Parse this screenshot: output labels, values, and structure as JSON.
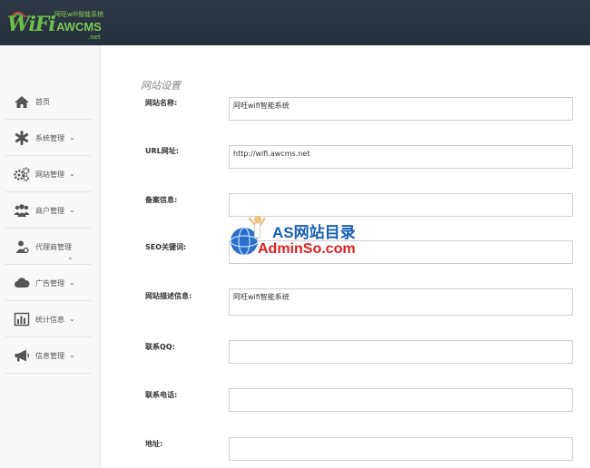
{
  "header": {
    "logo_small_text": "阿旺wifi智能系统",
    "logo_wifi": "WiFi",
    "logo_brand": "AWCMS",
    "logo_net": ".net"
  },
  "sidebar": {
    "items": [
      {
        "label": "首页",
        "icon": "home-icon",
        "has_chevron": false
      },
      {
        "label": "系统管理",
        "icon": "asterisk-icon",
        "has_chevron": true
      },
      {
        "label": "网站管理",
        "icon": "gears-icon",
        "has_chevron": true
      },
      {
        "label": "商户管理",
        "icon": "users-icon",
        "has_chevron": true
      },
      {
        "label": "代理商管理",
        "icon": "agent-icon",
        "has_chevron": true
      },
      {
        "label": "广告管理",
        "icon": "cloud-icon",
        "has_chevron": true
      },
      {
        "label": "统计信息",
        "icon": "bar-chart-icon",
        "has_chevron": true
      },
      {
        "label": "信息管理",
        "icon": "megaphone-icon",
        "has_chevron": true
      }
    ],
    "chevron": "⌄"
  },
  "main": {
    "section_title": "网站设置",
    "fields": [
      {
        "label": "网站名称:",
        "value": "阿旺wifi智能系统"
      },
      {
        "label": "URL网址:",
        "value": "http://wifi.awcms.net"
      },
      {
        "label": "备案信息:",
        "value": ""
      },
      {
        "label": "SEO关键词:",
        "value": ""
      },
      {
        "label": "网站描述信息:",
        "value": "阿旺wifi智能系统"
      },
      {
        "label": "联系QQ:",
        "value": ""
      },
      {
        "label": "联系电话:",
        "value": ""
      },
      {
        "label": "地址:",
        "value": ""
      }
    ]
  },
  "watermark": {
    "title": "AS网站目录",
    "subtitle": "AdminSo.com"
  },
  "colors": {
    "topbar": "#2b3540",
    "logo_green": "#6cc04a",
    "watermark_blue": "#1a5fb4",
    "watermark_red": "#e02020"
  }
}
